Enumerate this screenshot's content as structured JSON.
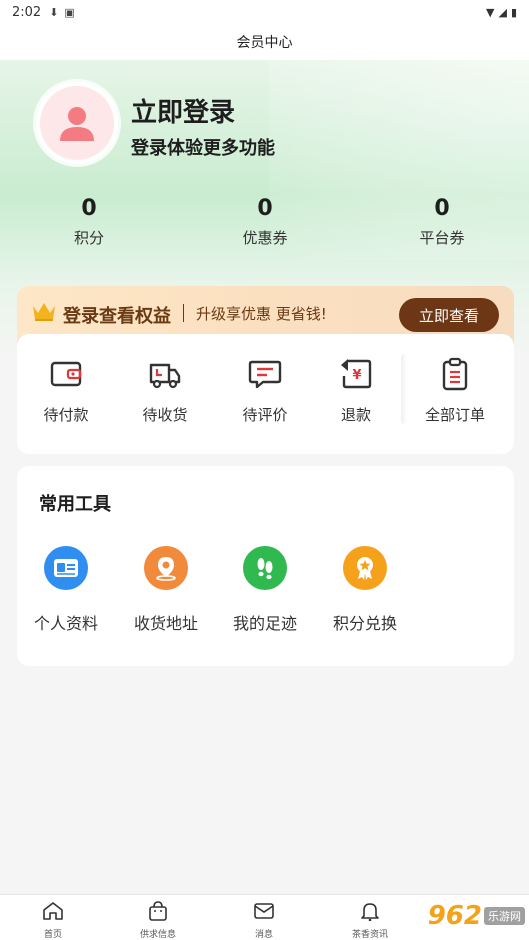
{
  "status_bar": {
    "time": "2:02"
  },
  "header": {
    "title": "会员中心"
  },
  "profile": {
    "login_title": "立即登录",
    "login_subtitle": "登录体验更多功能"
  },
  "stats": [
    {
      "value": "0",
      "label": "积分"
    },
    {
      "value": "0",
      "label": "优惠券"
    },
    {
      "value": "0",
      "label": "平台券"
    }
  ],
  "benefit": {
    "title": "登录查看权益",
    "desc": "升级享优惠 更省钱!",
    "button": "立即查看"
  },
  "orders": [
    {
      "label": "待付款",
      "icon": "wallet-icon"
    },
    {
      "label": "待收货",
      "icon": "truck-icon"
    },
    {
      "label": "待评价",
      "icon": "comment-icon"
    },
    {
      "label": "退款",
      "icon": "refund-icon"
    },
    {
      "label": "全部订单",
      "icon": "clipboard-icon"
    }
  ],
  "tools": {
    "title": "常用工具",
    "items": [
      {
        "label": "个人资料",
        "icon": "id-card-icon",
        "color": "#2f8ef0"
      },
      {
        "label": "收货地址",
        "icon": "location-icon",
        "color": "#f28a3c"
      },
      {
        "label": "我的足迹",
        "icon": "footprint-icon",
        "color": "#2fb94f"
      },
      {
        "label": "积分兑换",
        "icon": "medal-icon",
        "color": "#f5a11c"
      }
    ]
  },
  "tabbar": [
    {
      "label": "首页",
      "icon": "home-icon"
    },
    {
      "label": "供求信息",
      "icon": "bag-icon"
    },
    {
      "label": "消息",
      "icon": "mail-icon"
    },
    {
      "label": "茶香资讯",
      "icon": "bell-icon"
    }
  ],
  "watermark": {
    "number": "962",
    "text": "乐游网"
  },
  "colors": {
    "accent_brown": "#6d3615",
    "icon_red": "#e0373b"
  }
}
